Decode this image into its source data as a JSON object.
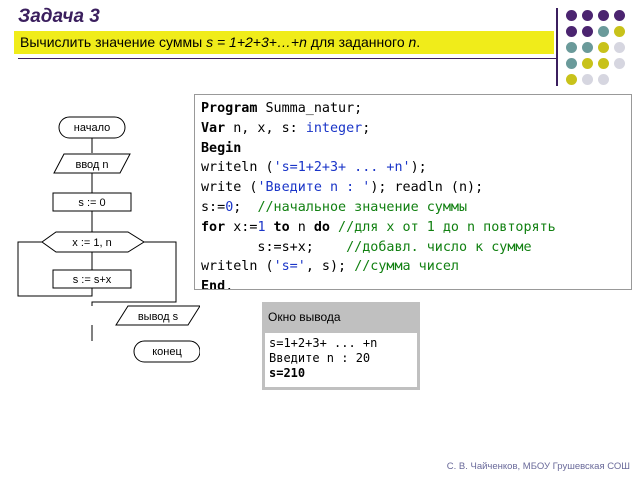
{
  "title": "Задача 3",
  "task": {
    "prefix": "Вычислить значение суммы ",
    "formula": "s = 1+2+3+…+n",
    "middle": "  для заданного ",
    "var": "n",
    "suffix": "."
  },
  "flowchart": {
    "start": "начало",
    "input": "ввод n",
    "init": "s := 0",
    "loop": "x := 1, n",
    "body": "s := s+x",
    "output": "вывод s",
    "end": "конец"
  },
  "code": {
    "l1_kw": "Program",
    "l1_rest": " Summa_natur;",
    "l2_kw": "Var",
    "l2_mid": " n, x, s: ",
    "l2_type": "integer",
    "l2_end": ";",
    "l3_kw": "Begin",
    "l4_a": "writeln (",
    "l4_str": "'s=1+2+3+ ... +n'",
    "l4_b": ");",
    "l5_a": "write (",
    "l5_str": "'Введите n : '",
    "l5_b": "); readln (n);",
    "l6_a": "s:=",
    "l6_num": "0",
    "l6_b": ";  ",
    "l6_cm": "//начальное значение суммы",
    "l7_for": "for",
    "l7_a": " x:=",
    "l7_num": "1",
    "l7_to": " to",
    "l7_b": " n ",
    "l7_do": "do",
    "l7_cm": " //для x от 1 до n повторять",
    "l8_a": "       s:=s+x;    ",
    "l8_cm": "//добавл. число к сумме",
    "l9_a": "writeln (",
    "l9_str": "'s='",
    "l9_b": ", s); ",
    "l9_cm": "//сумма чисел",
    "l10_kw": "End",
    "l10_b": "."
  },
  "output_window": {
    "title": "Окно вывода",
    "line1": "s=1+2+3+ ... +n",
    "line2": "Введите n : 20",
    "line3": "s=210"
  },
  "footer": "С. В. Чайченков, МБОУ Грушевская СОШ",
  "colors": {
    "accent_bar": "#f0ec1a",
    "title": "#3b1f5e",
    "dot_purple": "#4b2470",
    "dot_teal": "#6a9a9a",
    "dot_yellow": "#c8c21a",
    "dot_light": "#d6d6e0"
  }
}
